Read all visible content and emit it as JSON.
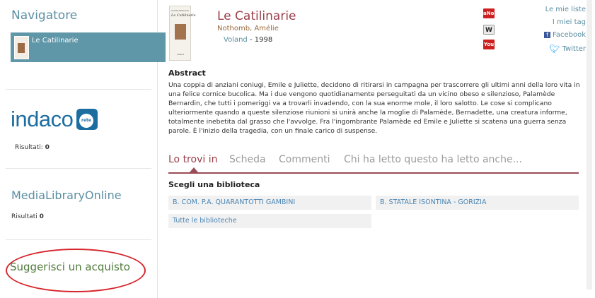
{
  "sidebar": {
    "navigator_title": "Navigatore",
    "navigator_item": "Le Catilinarie",
    "indaco": {
      "logo_word": "indaco",
      "logo_badge": "rete",
      "results_label": "Risultati:",
      "results_value": "0"
    },
    "mlol": {
      "title": "MediaLibraryOnline",
      "results_label": "Risultati",
      "results_value": "0"
    },
    "suggest_purchase": "Suggerisci un acquisto"
  },
  "book": {
    "title": "Le Catilinarie",
    "author": "Nothomb, Amélie",
    "publisher": "Voland",
    "year_sep": " - ",
    "year": "1998",
    "cover_title": "Le Catilinarie",
    "cover_author": "Amélie Nothomb",
    "cover_publisher": "Voland"
  },
  "share": {
    "icons": [
      "anobii-icon",
      "wikipedia-icon",
      "youtube-icon"
    ],
    "icon_labels": [
      "aNobii",
      "W",
      "You"
    ],
    "links": [
      "Le mie liste",
      "I miei tag",
      "Facebook",
      "Twitter"
    ]
  },
  "abstract": {
    "heading": "Abstract",
    "text": "Una coppia di anziani coniugi, Emile e Juliette, decidono di ritirarsi in campagna per trascorrere gli ultimi anni della loro vita in una felice cornice bucolica. Ma i due vengono quotidianamente perseguitati da un vicino obeso e silenzioso, Palamède Bernardin, che tutti i pomeriggi va a trovarli invadendo, con la sua enorme mole, il loro salotto. Le cose si complicano ulteriormente quando a queste silenziose riunioni si unirà anche la moglie di Palamède, Bernadette, una creatura informe, totalmente inebetita dal grasso che l'avvolge. Fra l'ingombrante Palamède ed Emile e Juliette si scatena una guerra senza parole. È l'inizio della tragedia, con un finale carico di suspense."
  },
  "tabs": [
    "Lo trovi in",
    "Scheda",
    "Commenti",
    "Chi ha letto questo ha letto anche..."
  ],
  "libraries": {
    "heading": "Scegli una biblioteca",
    "items": [
      "B. COM. P.A. QUARANTOTTI GAMBINI",
      "B. STATALE ISONTINA - GORIZIA",
      "Tutte le biblioteche"
    ]
  },
  "colors": {
    "accent_blue": "#5b8fa3",
    "title_red": "#9a3f4a",
    "highlight_oval": "#d7262d"
  }
}
